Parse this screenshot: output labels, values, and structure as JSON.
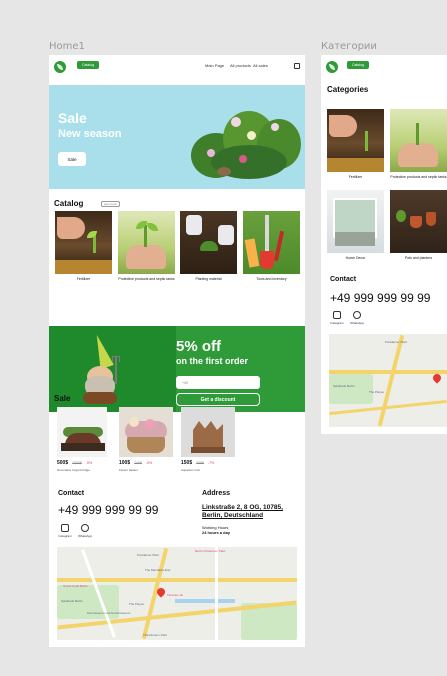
{
  "frames": {
    "home_label": "Home1",
    "categories_label": "Категории"
  },
  "header": {
    "catalog_btn": "Catalog",
    "nav": [
      "Main Page",
      "All products",
      "All sales"
    ]
  },
  "hero": {
    "title": "Sale",
    "subtitle": "New season",
    "button": "Sale"
  },
  "catalog": {
    "title": "Catalog",
    "chip": "see more",
    "items": [
      {
        "label": "Fertilizer"
      },
      {
        "label": "Protective products and septic tanks"
      },
      {
        "label": "Planting material"
      },
      {
        "label": "Tools and inventory"
      }
    ]
  },
  "promo": {
    "title": "5% off",
    "subtitle": "on the first order",
    "input_placeholder": "+49",
    "button": "Get a discount"
  },
  "sale": {
    "title": "Sale",
    "items": [
      {
        "price": "500$",
        "old_price": "1000$",
        "discount": "-5%",
        "name": "Decorative forged bridge"
      },
      {
        "price": "100$",
        "old_price": "140$",
        "discount": "-5%",
        "name": "Flower basket"
      },
      {
        "price": "150$",
        "old_price": "200$",
        "discount": "-7%",
        "name": "Aquarium lock"
      }
    ]
  },
  "contact": {
    "title": "Contact",
    "phone": "+49 999 999 99 99",
    "socials": [
      {
        "label": "Instagram"
      },
      {
        "label": "WhatsApp"
      }
    ],
    "address_title": "Address",
    "address": "Linkstraße 2, 8 OG, 10785, Berlin, Deutschland",
    "hours_label": "Working Hours",
    "hours_value": "24 hours a day"
  },
  "map": {
    "labels": [
      "Berlin Potsdamer Platz",
      "Potsdamer Platz",
      "The Mandala Hotel",
      "Grand Hyatt Berlin",
      "Spielbank Berlin",
      "The Playce",
      "Kinomuseum und Kunstmuseum",
      "Tilla-Durieux-Park",
      "Tierarten.de"
    ]
  },
  "categories_page": {
    "title": "Categories",
    "items": [
      {
        "label": "Fertilizer"
      },
      {
        "label": "Protective products and septic tanks"
      },
      {
        "label": "Home Decor"
      },
      {
        "label": "Pots and planters"
      }
    ],
    "contact_title": "Contact",
    "phone": "+49 999 999 99 99",
    "socials": [
      {
        "label": "Instagram"
      },
      {
        "label": "WhatsApp"
      }
    ]
  }
}
